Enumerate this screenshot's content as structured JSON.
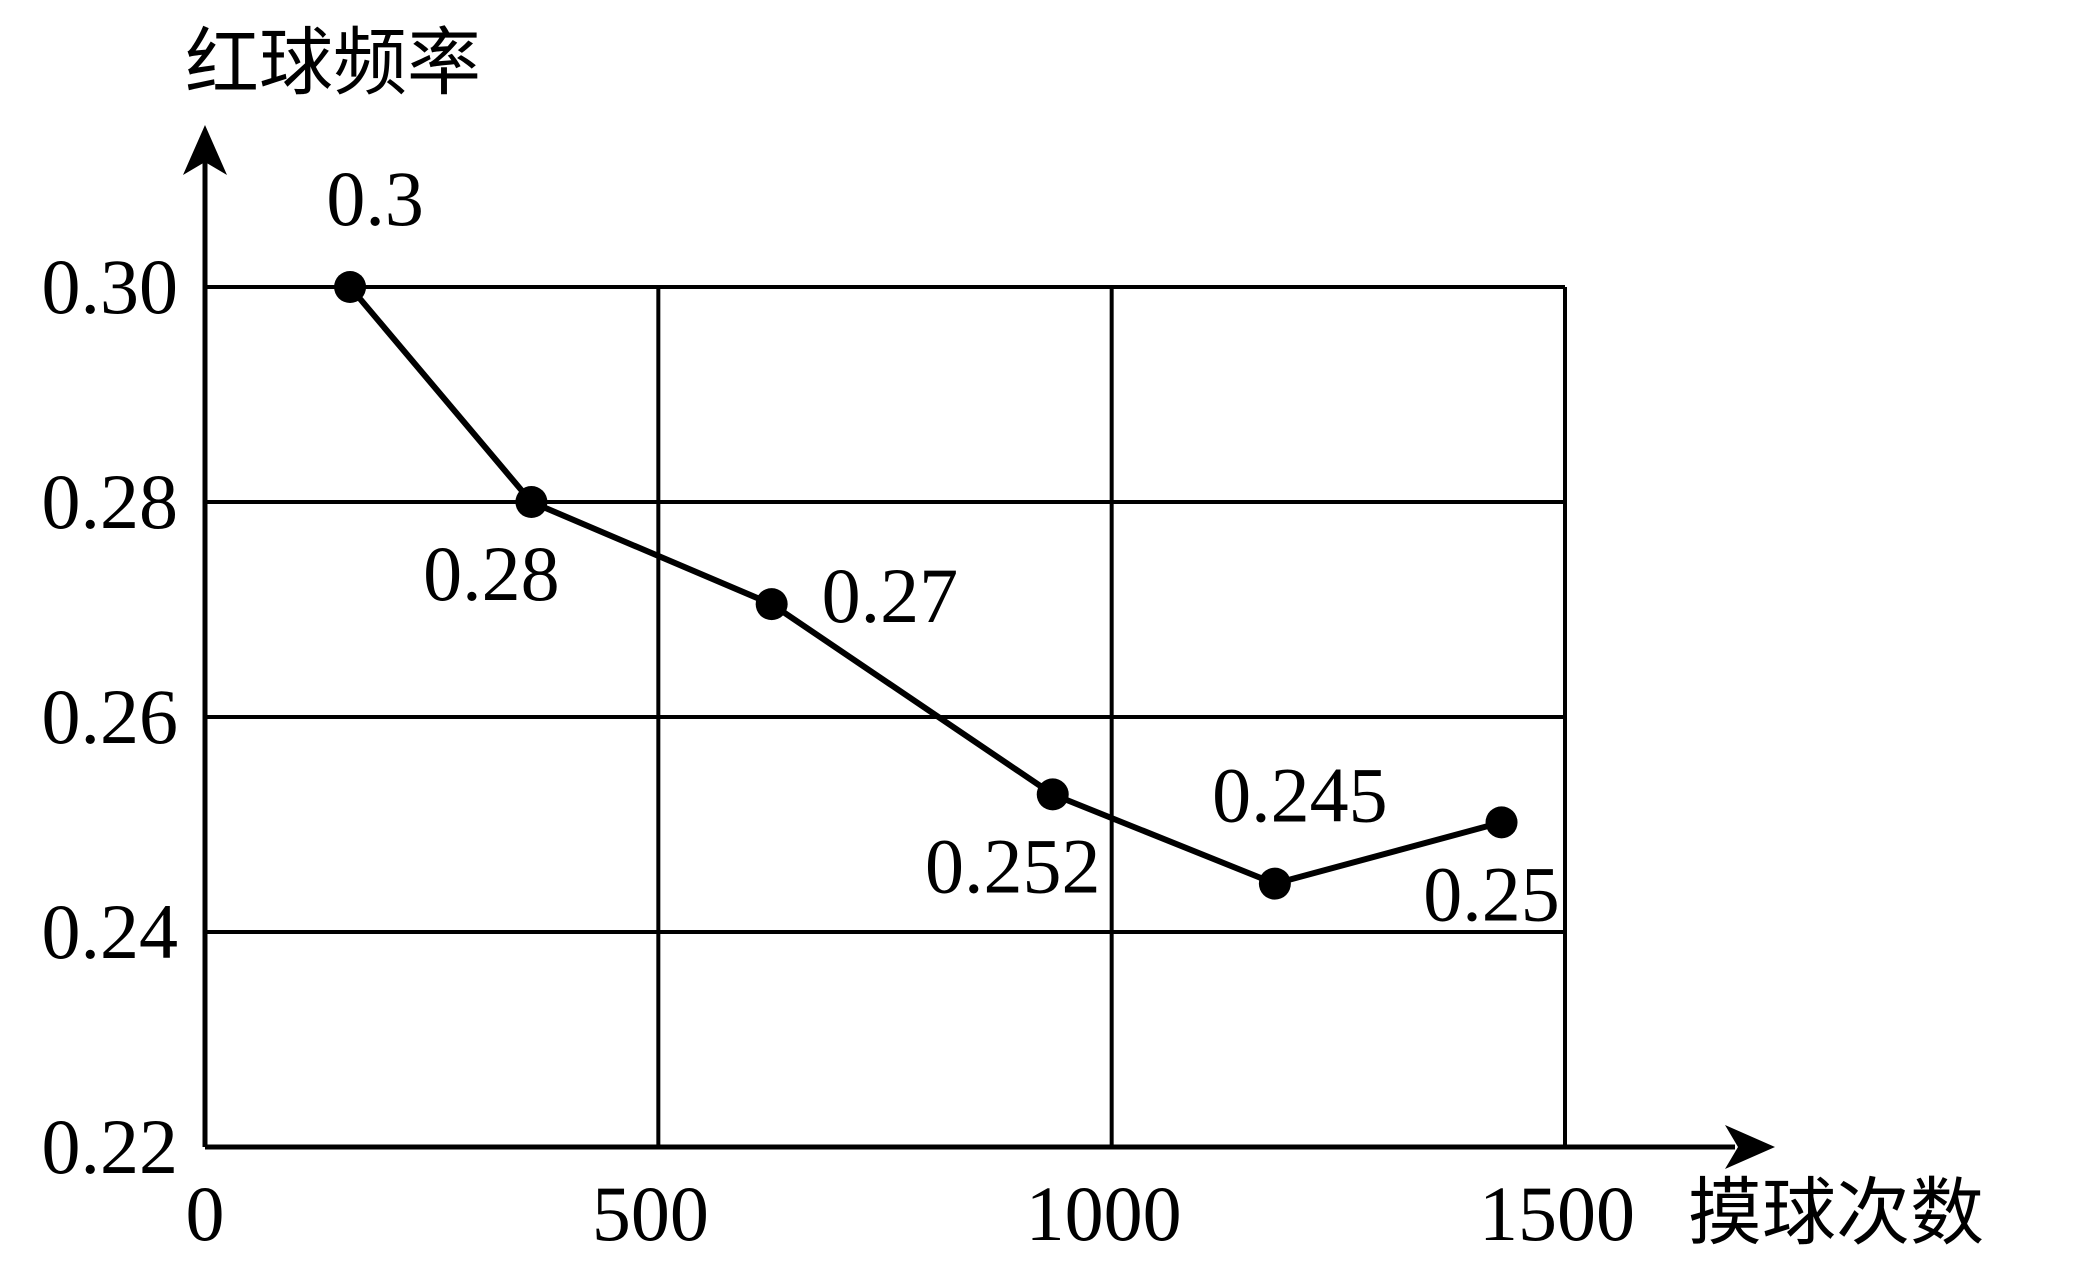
{
  "chart_data": {
    "type": "line",
    "ylabel": "红球频率",
    "xlabel": "摸球次数",
    "xlim": [
      0,
      1500
    ],
    "ylim": [
      0.22,
      0.3
    ],
    "x_ticks": [
      "0",
      "500",
      "1000",
      "1500"
    ],
    "y_ticks": [
      "0.22",
      "0.24",
      "0.26",
      "0.28",
      "0.30"
    ],
    "grid": true,
    "series": [
      {
        "points": [
          {
            "x": 160,
            "y": 0.3,
            "label": "0.3",
            "label_pos": "above"
          },
          {
            "x": 360,
            "y": 0.28,
            "label": "0.28",
            "label_pos": "below-left"
          },
          {
            "x": 625,
            "y": 0.2705,
            "label": "0.27",
            "label_pos": "right"
          },
          {
            "x": 935,
            "y": 0.2528,
            "label": "0.252",
            "label_pos": "below-left"
          },
          {
            "x": 1180,
            "y": 0.2445,
            "label": "0.245",
            "label_pos": "above"
          },
          {
            "x": 1430,
            "y": 0.2502,
            "label": "0.25",
            "label_pos": "below"
          }
        ]
      }
    ]
  }
}
